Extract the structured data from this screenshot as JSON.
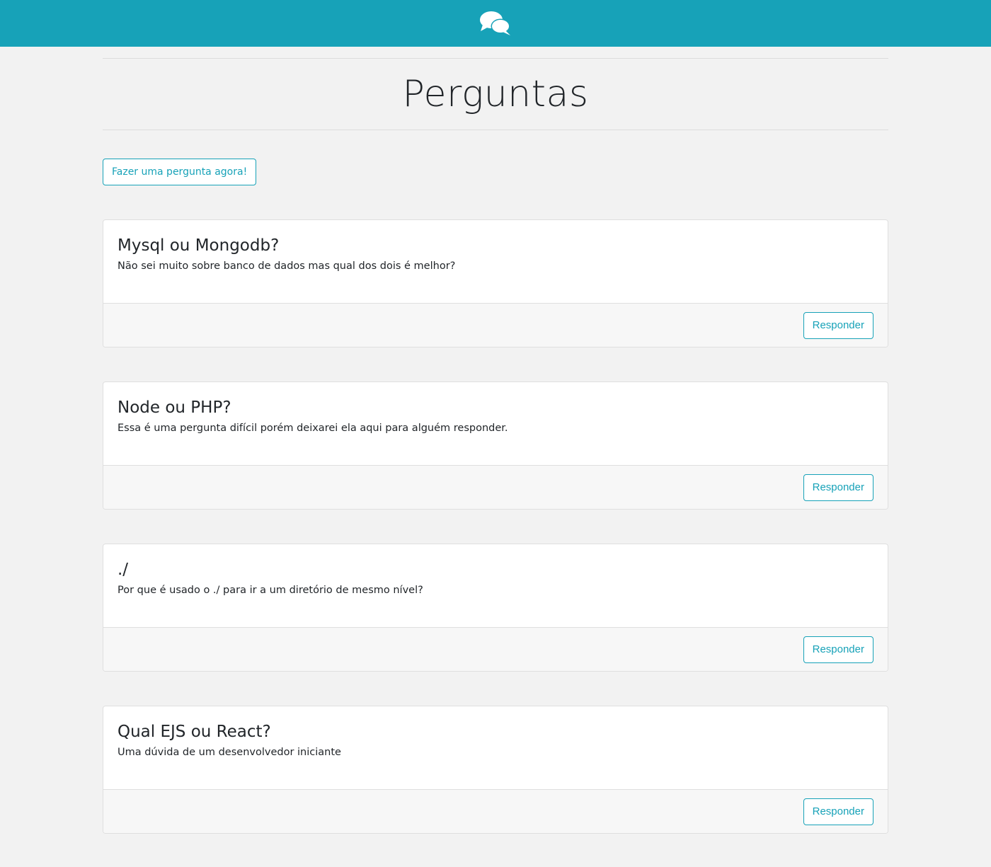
{
  "navbar": {
    "logo_icon": "comments-icon",
    "background_color": "#17a2b8"
  },
  "page": {
    "title": "Perguntas",
    "ask_button_label": "Fazer uma pergunta agora!"
  },
  "questions": [
    {
      "title": "Mysql ou Mongodb?",
      "description": "Não sei muito sobre banco de dados mas qual dos dois é melhor?",
      "answer_label": "Responder"
    },
    {
      "title": "Node ou PHP?",
      "description": "Essa é uma pergunta difícil porém deixarei ela aqui para alguém responder.",
      "answer_label": "Responder"
    },
    {
      "title": "./",
      "description": "Por que é usado o ./ para ir a um diretório de mesmo nível?",
      "answer_label": "Responder"
    },
    {
      "title": "Qual EJS ou React?",
      "description": "Uma dúvida de um desenvolvedor iniciante",
      "answer_label": "Responder"
    }
  ],
  "colors": {
    "accent": "#17a2b8",
    "page_background": "#f2f2f2",
    "card_footer": "#f7f7f7"
  }
}
